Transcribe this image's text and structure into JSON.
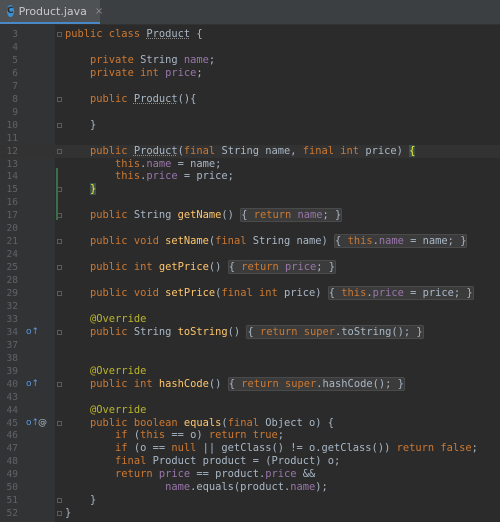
{
  "tab": {
    "label": "Product.java",
    "close": "×",
    "icon": "C"
  },
  "gutter_icons": {
    "override_icon": "o↑",
    "at_icon": "@"
  },
  "lines": [
    {
      "n": "3",
      "html": "<span class='k'>public class </span><span class='cls'>Product</span> {"
    },
    {
      "n": "4",
      "html": ""
    },
    {
      "n": "5",
      "html": "    <span class='k'>private </span>String <span class='f'>name</span>;"
    },
    {
      "n": "6",
      "html": "    <span class='k'>private int </span><span class='f'>price</span>;"
    },
    {
      "n": "7",
      "html": ""
    },
    {
      "n": "8",
      "html": "    <span class='k'>public </span><span class='cls'>Product</span>(){"
    },
    {
      "n": "9",
      "html": ""
    },
    {
      "n": "10",
      "html": "    }"
    },
    {
      "n": "11",
      "html": ""
    },
    {
      "n": "12",
      "html": "    <span class='k'>public </span><span class='cls'>Product</span>(<span class='k'>final </span>String name, <span class='k'>final int </span>price) <span class='brace-hl'>{</span>",
      "caret": true
    },
    {
      "n": "13",
      "html": "        <span class='k'>this</span>.<span class='f'>name</span> = name;"
    },
    {
      "n": "14",
      "html": "        <span class='k'>this</span>.<span class='f'>price</span> = price;"
    },
    {
      "n": "15",
      "html": "    <span class='brace-hl'>}</span>"
    },
    {
      "n": "16",
      "html": ""
    },
    {
      "n": "17",
      "html": "    <span class='k'>public </span>String <span class='m'>getName</span>() <span class='fold'>{ <span class='k'>return </span><span class='f'>name</span>; }</span>"
    },
    {
      "n": "20",
      "html": ""
    },
    {
      "n": "21",
      "html": "    <span class='k'>public void </span><span class='m'>setName</span>(<span class='k'>final </span>String name) <span class='fold'>{ <span class='k'>this</span>.<span class='f'>name</span> = name; }</span>"
    },
    {
      "n": "24",
      "html": ""
    },
    {
      "n": "25",
      "html": "    <span class='k'>public int </span><span class='m'>getPrice</span>() <span class='fold'>{ <span class='k'>return </span><span class='f'>price</span>; }</span>"
    },
    {
      "n": "28",
      "html": ""
    },
    {
      "n": "29",
      "html": "    <span class='k'>public void </span><span class='m'>setPrice</span>(<span class='k'>final int </span>price) <span class='fold'>{ <span class='k'>this</span>.<span class='f'>price</span> = price; }</span>"
    },
    {
      "n": "32",
      "html": ""
    },
    {
      "n": "33",
      "html": "    <span class='a'>@Override</span>"
    },
    {
      "n": "34",
      "html": "    <span class='k'>public </span>String <span class='m'>toString</span>() <span class='fold'>{ <span class='k'>return super</span>.toString(); }</span>",
      "icon": "override"
    },
    {
      "n": "37",
      "html": ""
    },
    {
      "n": "38",
      "html": ""
    },
    {
      "n": "39",
      "html": "    <span class='a'>@Override</span>"
    },
    {
      "n": "40",
      "html": "    <span class='k'>public int </span><span class='m'>hashCode</span>() <span class='fold'>{ <span class='k'>return super</span>.hashCode(); }</span>",
      "icon": "override"
    },
    {
      "n": "43",
      "html": ""
    },
    {
      "n": "44",
      "html": "    <span class='a'>@Override</span>"
    },
    {
      "n": "45",
      "html": "    <span class='k'>public boolean </span><span class='m'>equals</span>(<span class='k'>final </span>Object o) {",
      "icon": "override-at"
    },
    {
      "n": "46",
      "html": "        <span class='k'>if </span>(<span class='k'>this </span>== o) <span class='k'>return true</span>;"
    },
    {
      "n": "47",
      "html": "        <span class='k'>if </span>(o == <span class='k'>null </span>|| getClass() != o.getClass()) <span class='k'>return false</span>;"
    },
    {
      "n": "48",
      "html": "        <span class='k'>final </span>Product product = (Product) o;"
    },
    {
      "n": "49",
      "html": "        <span class='k'>return </span><span class='f'>price </span>== product.<span class='f'>price </span>&amp;&amp;"
    },
    {
      "n": "50",
      "html": "                <span class='f'>name</span>.equals(product.<span class='f'>name</span>);"
    },
    {
      "n": "51",
      "html": "    }"
    },
    {
      "n": "52",
      "html": "}"
    }
  ]
}
